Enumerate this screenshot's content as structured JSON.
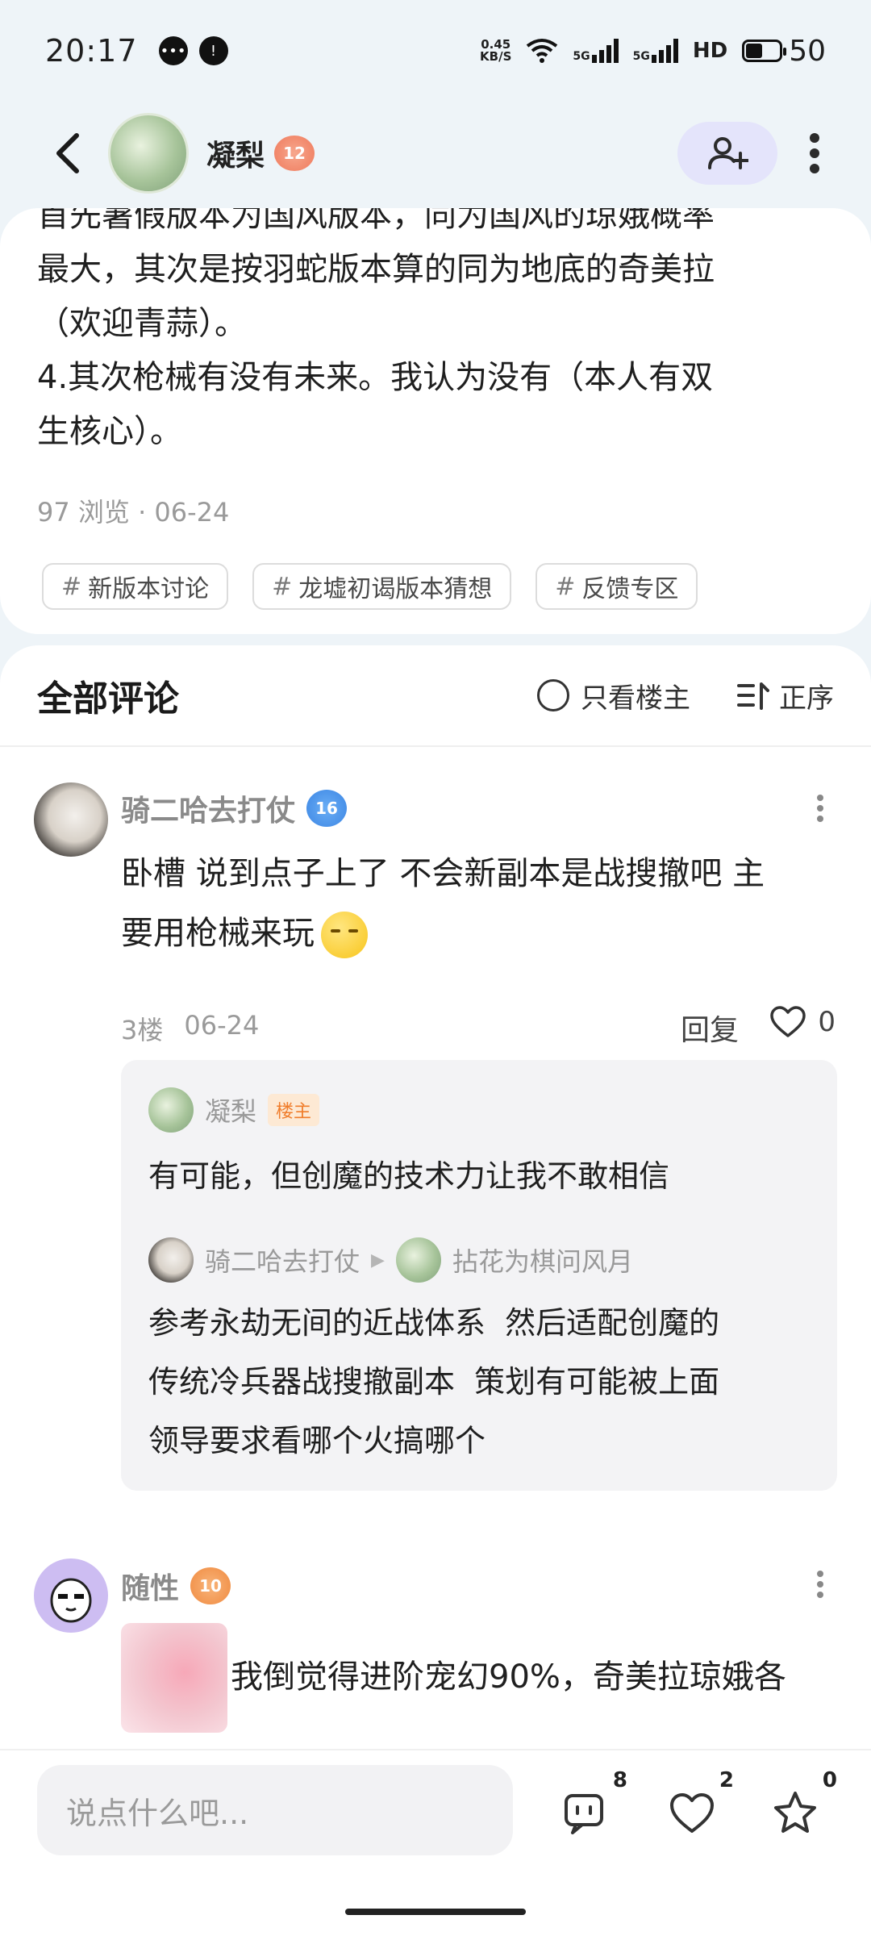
{
  "status_bar": {
    "time": "20:17",
    "net_speed_top": "0.45",
    "net_speed_bottom": "KB/S",
    "sig1_label": "5G",
    "sig2_label": "5G",
    "hd_label": "HD",
    "battery": "50",
    "battery_level_pct": 50
  },
  "header": {
    "username": "凝梨",
    "level": "12"
  },
  "post": {
    "text": "首先暑假版本为国风版本，同为国风的琼娥概率\n最大，其次是按羽蛇版本算的同为地底的奇美拉\n（欢迎青蒜）。\n4.其次枪械有没有未来。我认为没有（本人有双\n生核心）。",
    "meta": "97 浏览 · 06-24",
    "tags": [
      {
        "label": "新版本讨论"
      },
      {
        "label": "龙墟初谒版本猜想"
      },
      {
        "label": "反馈专区"
      }
    ]
  },
  "comments_header": {
    "title": "全部评论",
    "only_op": "只看楼主",
    "sort": "正序"
  },
  "comments": [
    {
      "name": "骑二哈去打仗",
      "level": "16",
      "text_line1": "卧槽 说到点子上了  不会新副本是战搜撤吧  主",
      "text_line2": "要用枪械来玩",
      "floor": "3楼",
      "date": "06-24",
      "reply_label": "回复",
      "likes": "0",
      "replies": [
        {
          "name": "凝梨",
          "badge": "楼主",
          "text": "有可能，但创魔的技术力让我不敢相信"
        },
        {
          "name": "骑二哈去打仗",
          "to": "拈花为棋问风月",
          "text": "参考永劫无间的近战体系  然后适配创魔的\n传统冷兵器战搜撤副本  策划有可能被上面\n领导要求看哪个火搞哪个"
        }
      ]
    },
    {
      "name": "随性",
      "level": "10",
      "text": "我倒觉得进阶宠幻90%，奇美拉琼娥各"
    }
  ],
  "bottom_bar": {
    "placeholder": "说点什么吧...",
    "comment_count": "8",
    "like_count": "2",
    "star_count": "0"
  }
}
